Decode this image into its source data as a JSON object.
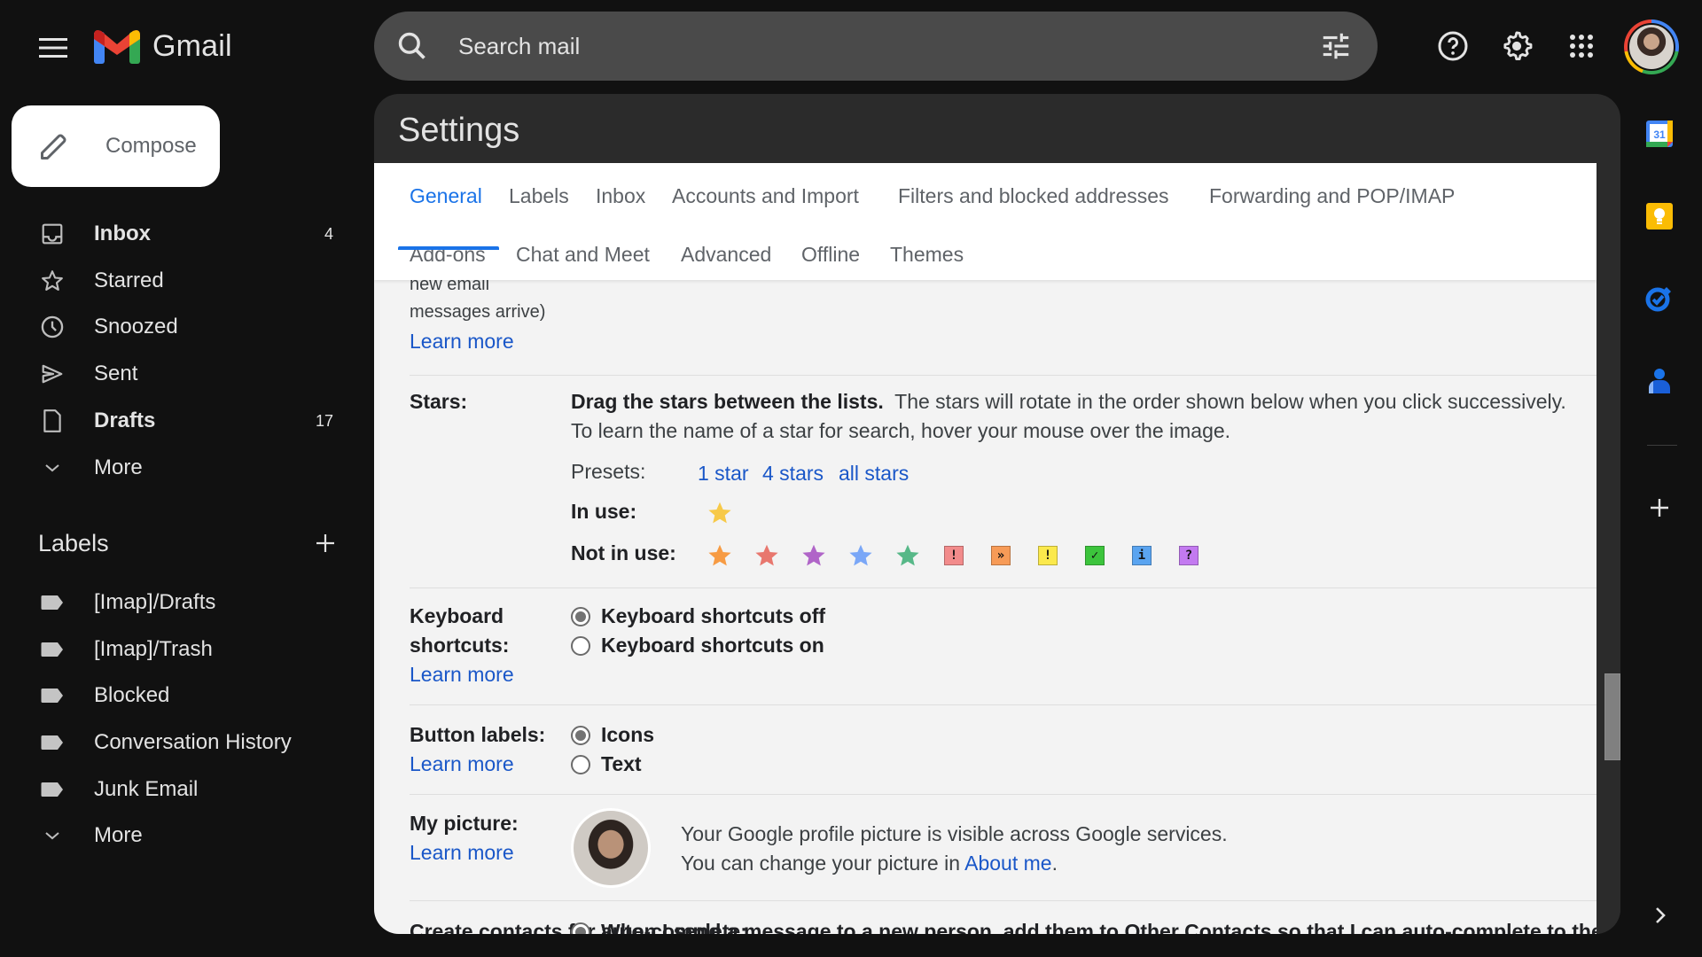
{
  "app": {
    "name": "Gmail"
  },
  "search": {
    "placeholder": "Search mail"
  },
  "compose": {
    "label": "Compose"
  },
  "nav": [
    {
      "label": "Inbox",
      "count": "4",
      "bold": true,
      "icon": "inbox-icon"
    },
    {
      "label": "Starred",
      "count": "",
      "bold": false,
      "icon": "star-icon"
    },
    {
      "label": "Snoozed",
      "count": "",
      "bold": false,
      "icon": "clock-icon"
    },
    {
      "label": "Sent",
      "count": "",
      "bold": false,
      "icon": "send-icon"
    },
    {
      "label": "Drafts",
      "count": "17",
      "bold": true,
      "icon": "draft-icon"
    },
    {
      "label": "More",
      "count": "",
      "bold": false,
      "icon": "chevron-down-icon"
    }
  ],
  "labels": {
    "heading": "Labels",
    "items": [
      "[Imap]/Drafts",
      "[Imap]/Trash",
      "Blocked",
      "Conversation History",
      "Junk Email"
    ],
    "more": "More"
  },
  "settings": {
    "title": "Settings",
    "tabs_row1": [
      "General",
      "Labels",
      "Inbox",
      "Accounts and Import",
      "Filters and blocked addresses",
      "Forwarding and POP/IMAP"
    ],
    "tabs_row2": [
      "Add-ons",
      "Chat and Meet",
      "Advanced",
      "Offline",
      "Themes"
    ],
    "active_tab": "General",
    "prev_section": {
      "line1": "new email",
      "line2": "messages arrive)",
      "learn_more": "Learn more"
    },
    "stars": {
      "label": "Stars:",
      "desc_bold": "Drag the stars between the lists.",
      "desc_rest": "The stars will rotate in the order shown below when you click successively.",
      "desc_line2": "To learn the name of a star for search, hover your mouse over the image.",
      "presets_label": "Presets:",
      "presets": [
        "1 star",
        "4 stars",
        "all stars"
      ],
      "in_use_label": "In use:",
      "in_use": [
        {
          "name": "yellow-star",
          "color": "#f7c948"
        }
      ],
      "not_in_use_label": "Not in use:",
      "not_in_use_stars": [
        {
          "name": "orange-star",
          "color": "#f79b43"
        },
        {
          "name": "red-star",
          "color": "#e8776e"
        },
        {
          "name": "purple-star",
          "color": "#b065c8"
        },
        {
          "name": "blue-star",
          "color": "#7aa7f7"
        },
        {
          "name": "green-star",
          "color": "#57b888"
        }
      ],
      "not_in_use_boxes": [
        {
          "name": "red-bang",
          "glyph": "!",
          "color": "#f28b8b"
        },
        {
          "name": "orange-guillemet",
          "glyph": "»",
          "color": "#f79b57"
        },
        {
          "name": "yellow-bang",
          "glyph": "!",
          "color": "#fbe94c"
        },
        {
          "name": "green-check",
          "glyph": "✓",
          "color": "#3cc43c"
        },
        {
          "name": "blue-info",
          "glyph": "i",
          "color": "#5aa4f0"
        },
        {
          "name": "purple-question",
          "glyph": "?",
          "color": "#c37af0"
        }
      ]
    },
    "keyboard": {
      "label_line1": "Keyboard",
      "label_line2": "shortcuts:",
      "learn_more": "Learn more",
      "options": [
        "Keyboard shortcuts off",
        "Keyboard shortcuts on"
      ],
      "selected": "Keyboard shortcuts off"
    },
    "button_labels": {
      "label": "Button labels:",
      "learn_more": "Learn more",
      "options": [
        "Icons",
        "Text"
      ],
      "selected": "Icons"
    },
    "my_picture": {
      "label": "My picture:",
      "learn_more": "Learn more",
      "line1": "Your Google profile picture is visible across Google services.",
      "line2_prefix": "You can change your picture in ",
      "line2_link": "About me",
      "line2_suffix": "."
    },
    "create_contacts": {
      "label": "Create contacts for auto-complete:",
      "option": "When I send a message to a new person, add them to Other Contacts so that I can auto-complete to them next time"
    }
  },
  "side_apps": [
    "calendar-app",
    "keep-app",
    "tasks-app",
    "contacts-app"
  ],
  "calendar_day": "31",
  "colors": {
    "accent": "#1a73e8",
    "link": "#1a57c8",
    "bg": "#111111",
    "panel": "#2b2b2b"
  }
}
